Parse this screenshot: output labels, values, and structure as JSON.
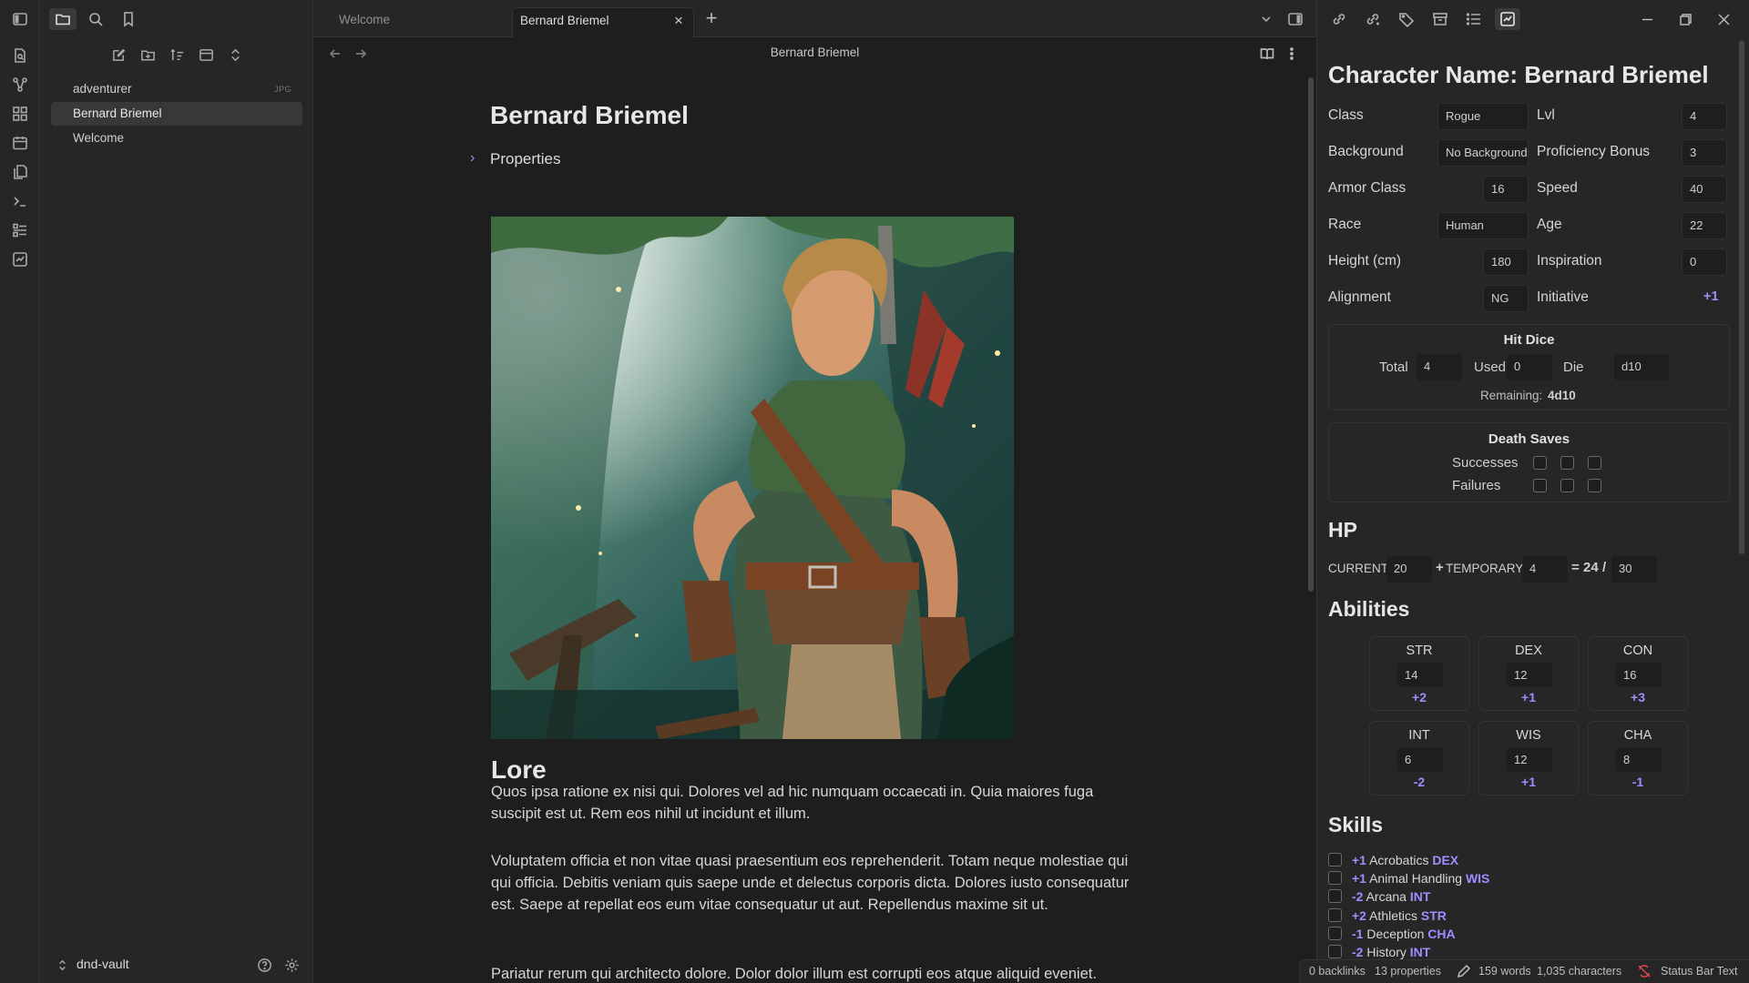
{
  "tabs": [
    {
      "label": "Welcome",
      "active": false
    },
    {
      "label": "Bernard Briemel",
      "active": true
    }
  ],
  "file_tree": [
    {
      "label": "adventurer",
      "ext": "JPG",
      "active": false
    },
    {
      "label": "Bernard Briemel",
      "ext": "",
      "active": true
    },
    {
      "label": "Welcome",
      "ext": "",
      "active": false
    }
  ],
  "vault": {
    "name": "dnd-vault"
  },
  "editor": {
    "view_title": "Bernard Briemel",
    "note_title": "Bernard Briemel",
    "properties_label": "Properties",
    "lore_heading": "Lore",
    "lore_paragraphs": [
      "Quos ipsa ratione ex nisi qui. Dolores vel ad hic numquam occaecati in. Quia maiores fuga suscipit est ut. Rem eos nihil ut incidunt et illum.",
      "Voluptatem officia et non vitae quasi praesentium eos reprehenderit. Totam neque molestiae qui qui officia. Debitis veniam quis saepe unde et delectus corporis dicta. Dolores iusto consequatur est. Saepe at repellat eos eum vitae consequatur ut aut. Repellendus maxime sit ut.",
      "Pariatur rerum qui architecto dolore. Dolor dolor illum est corrupti eos atque aliquid eveniet."
    ]
  },
  "sheet": {
    "title": "Character Name: Bernard Briemel",
    "fields": {
      "class_label": "Class",
      "class_value": "Rogue",
      "lvl_label": "Lvl",
      "lvl_value": "4",
      "background_label": "Background",
      "background_value": "No Background",
      "prof_label": "Proficiency Bonus",
      "prof_value": "3",
      "ac_label": "Armor Class",
      "ac_value": "16",
      "speed_label": "Speed",
      "speed_value": "40",
      "race_label": "Race",
      "race_value": "Human",
      "age_label": "Age",
      "age_value": "22",
      "height_label": "Height (cm)",
      "height_value": "180",
      "inspiration_label": "Inspiration",
      "inspiration_value": "0",
      "alignment_label": "Alignment",
      "alignment_value": "NG",
      "initiative_label": "Initiative",
      "initiative_value": "+1"
    },
    "hit_dice": {
      "title": "Hit Dice",
      "total_label": "Total",
      "total_value": "4",
      "used_label": "Used",
      "used_value": "0",
      "die_label": "Die",
      "die_value": "d10",
      "remaining_label": "Remaining:",
      "remaining_value": "4d10"
    },
    "death_saves": {
      "title": "Death Saves",
      "successes_label": "Successes",
      "failures_label": "Failures",
      "successes": [
        false,
        false,
        false
      ],
      "failures": [
        false,
        false,
        false
      ]
    },
    "hp": {
      "heading": "HP",
      "current_label": "CURRENT",
      "current_value": "20",
      "plus": "+",
      "temp_label": "TEMPORARY",
      "temp_value": "4",
      "equals": "=",
      "total_value": "24",
      "slash": "/",
      "max_value": "30"
    },
    "abilities_heading": "Abilities",
    "abilities": [
      {
        "name": "STR",
        "score": "14",
        "mod": "+2"
      },
      {
        "name": "DEX",
        "score": "12",
        "mod": "+1"
      },
      {
        "name": "CON",
        "score": "16",
        "mod": "+3"
      },
      {
        "name": "INT",
        "score": "6",
        "mod": "-2"
      },
      {
        "name": "WIS",
        "score": "12",
        "mod": "+1"
      },
      {
        "name": "CHA",
        "score": "8",
        "mod": "-1"
      }
    ],
    "skills_heading": "Skills",
    "skills": [
      {
        "mod": "+1",
        "name": "Acrobatics",
        "ability": "DEX"
      },
      {
        "mod": "+1",
        "name": "Animal Handling",
        "ability": "WIS"
      },
      {
        "mod": "-2",
        "name": "Arcana",
        "ability": "INT"
      },
      {
        "mod": "+2",
        "name": "Athletics",
        "ability": "STR"
      },
      {
        "mod": "-1",
        "name": "Deception",
        "ability": "CHA"
      },
      {
        "mod": "-2",
        "name": "History",
        "ability": "INT"
      }
    ]
  },
  "status_bar": {
    "backlinks": "0 backlinks",
    "properties": "13 properties",
    "words": "159 words",
    "characters": "1,035 characters",
    "custom": "Status Bar Text"
  },
  "colors": {
    "accent": "#a08cff",
    "background": "#1e1e1e",
    "panel": "#262626"
  }
}
